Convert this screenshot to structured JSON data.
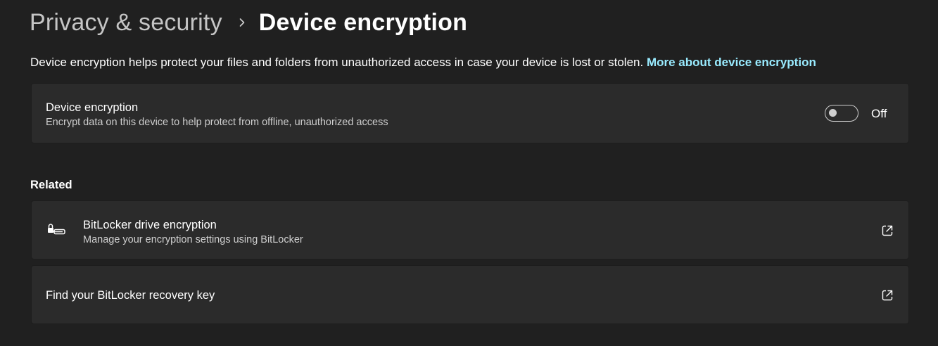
{
  "breadcrumb": {
    "parent": "Privacy & security",
    "separator_icon": "chevron-right-icon",
    "current": "Device encryption"
  },
  "description": {
    "text": "Device encryption helps protect your files and folders from unauthorized access in case your device is lost or stolen.",
    "link_label": "More about device encryption"
  },
  "device_encryption": {
    "title": "Device encryption",
    "subtitle": "Encrypt data on this device to help protect from offline, unauthorized access",
    "toggle_state": "Off",
    "enabled": false
  },
  "related": {
    "heading": "Related",
    "items": [
      {
        "title": "BitLocker drive encryption",
        "subtitle": "Manage your encryption settings using BitLocker",
        "icon": "bitlocker-key-icon",
        "action_icon": "open-external-icon"
      },
      {
        "title": "Find your BitLocker recovery key",
        "action_icon": "open-external-icon"
      }
    ]
  },
  "colors": {
    "background": "#202020",
    "card": "#2b2b2b",
    "accent_link": "#99ebff",
    "text_primary": "#ffffff",
    "text_secondary": "#cfcfcf",
    "breadcrumb_parent": "#c5c5c5"
  }
}
